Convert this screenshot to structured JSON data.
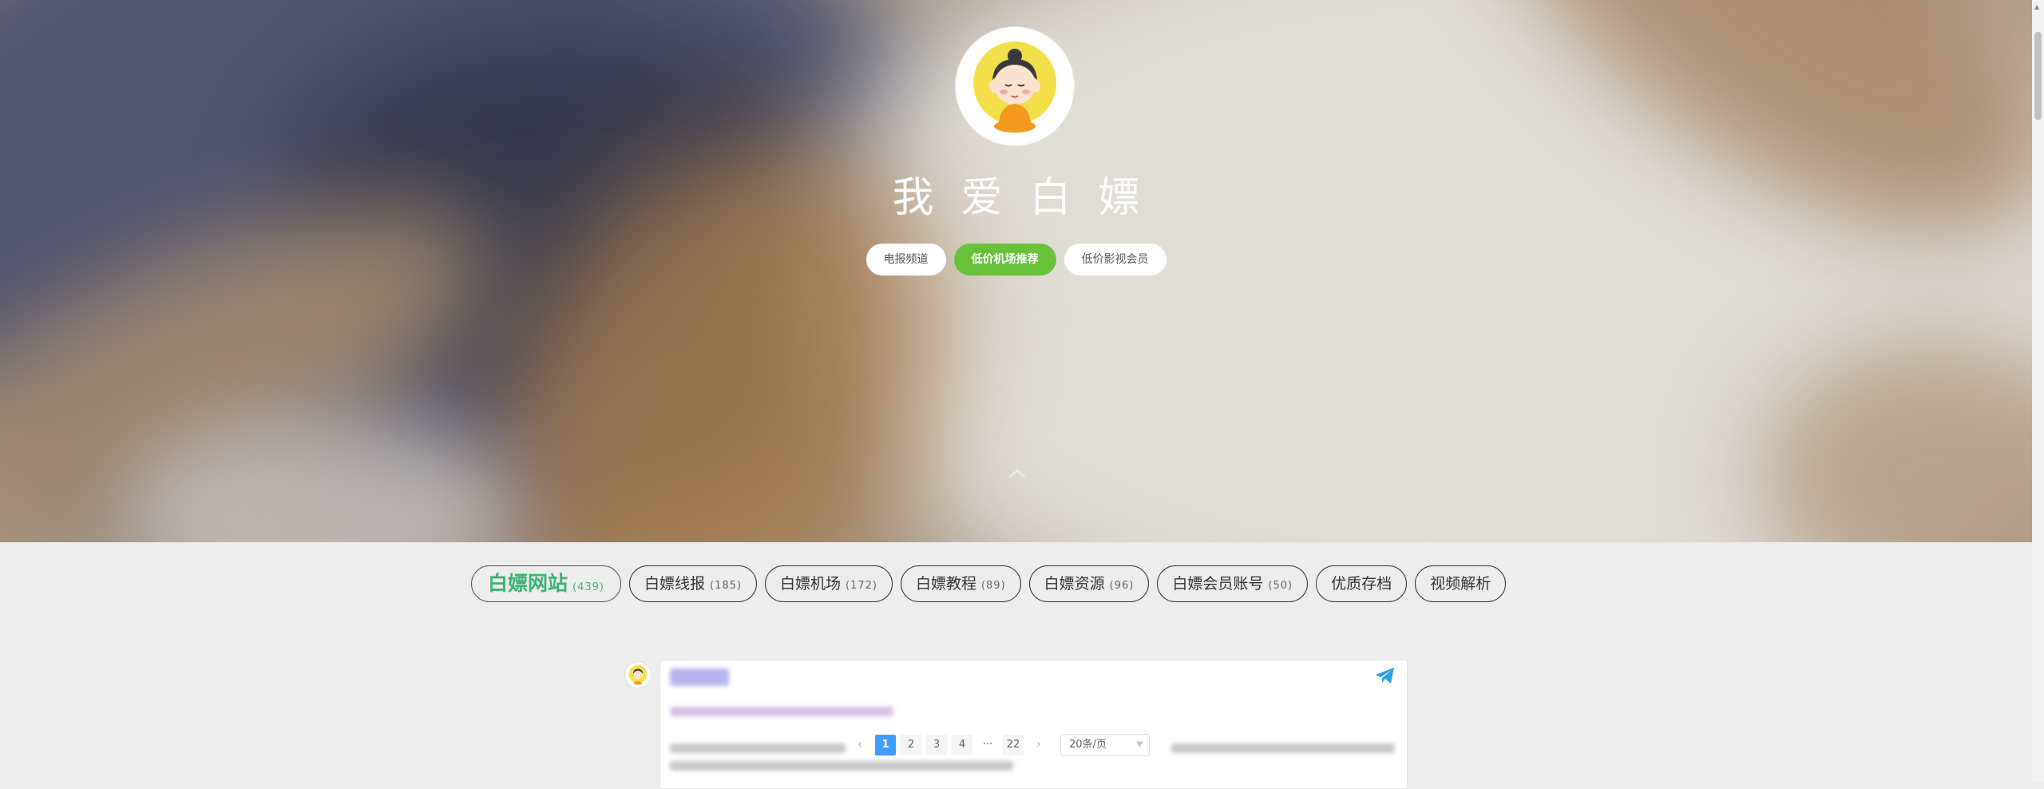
{
  "hero": {
    "site_title": "我爱白嫖",
    "buttons": [
      {
        "label": "电报频道",
        "active": false
      },
      {
        "label": "低价机场推荐",
        "active": true
      },
      {
        "label": "低价影视会员",
        "active": false
      }
    ]
  },
  "tabs": [
    {
      "label": "白嫖网站",
      "count": "(439)",
      "active": true
    },
    {
      "label": "白嫖线报",
      "count": "(185)"
    },
    {
      "label": "白嫖机场",
      "count": "(172)"
    },
    {
      "label": "白嫖教程",
      "count": "(89)"
    },
    {
      "label": "白嫖资源",
      "count": "(96)"
    },
    {
      "label": "白嫖会员账号",
      "count": "(50)"
    },
    {
      "label": "优质存档",
      "count": ""
    },
    {
      "label": "视频解析",
      "count": ""
    }
  ],
  "pagination": {
    "pages": [
      "1",
      "2",
      "3",
      "4"
    ],
    "ellipsis": "···",
    "last_page": "22",
    "current": "1",
    "page_size": "20条/页"
  },
  "colors": {
    "accent_green": "#67c23a",
    "tab_active": "#3cb371",
    "page_active": "#409eff",
    "telegram": "#2aa2df"
  },
  "icons": {
    "avatar": "buddha-avatar",
    "send": "telegram-send-icon",
    "prev": "chevron-left-icon",
    "next": "chevron-right-icon",
    "caret": "chevron-down-icon"
  }
}
